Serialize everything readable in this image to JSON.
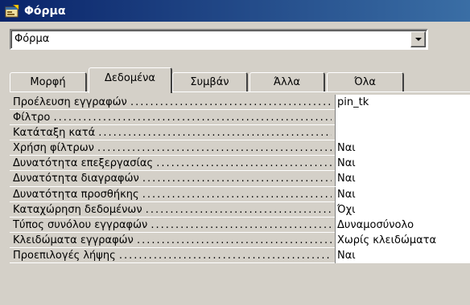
{
  "window": {
    "title": "Φόρμα",
    "icon": "form-properties-icon"
  },
  "selector": {
    "value": "Φόρμα",
    "options_visible": [
      "Φόρμα"
    ]
  },
  "tabs": [
    {
      "label": "Μορφή",
      "active": false
    },
    {
      "label": "Δεδομένα",
      "active": true
    },
    {
      "label": "Συμβάν",
      "active": false
    },
    {
      "label": "Άλλα",
      "active": false
    },
    {
      "label": "Όλα",
      "active": false
    }
  ],
  "properties": [
    {
      "label": "Προέλευση εγγραφών",
      "value": "pin_tk"
    },
    {
      "label": "Φίλτρο",
      "value": ""
    },
    {
      "label": "Κατάταξη κατά",
      "value": ""
    },
    {
      "label": "Χρήση φίλτρων",
      "value": "Ναι"
    },
    {
      "label": "Δυνατότητα επεξεργασίας",
      "value": "Ναι"
    },
    {
      "label": "Δυνατότητα διαγραφών",
      "value": "Ναι"
    },
    {
      "label": "Δυνατότητα προσθήκης",
      "value": "Ναι"
    },
    {
      "label": "Καταχώρηση δεδομένων",
      "value": "Όχι"
    },
    {
      "label": "Τύπος συνόλου εγγραφών",
      "value": "Δυναμοσύνολο"
    },
    {
      "label": "Κλειδώματα εγγραφών",
      "value": "Χωρίς κλειδώματα"
    },
    {
      "label": "Προεπιλογές λήψης",
      "value": "Ναι"
    }
  ]
}
